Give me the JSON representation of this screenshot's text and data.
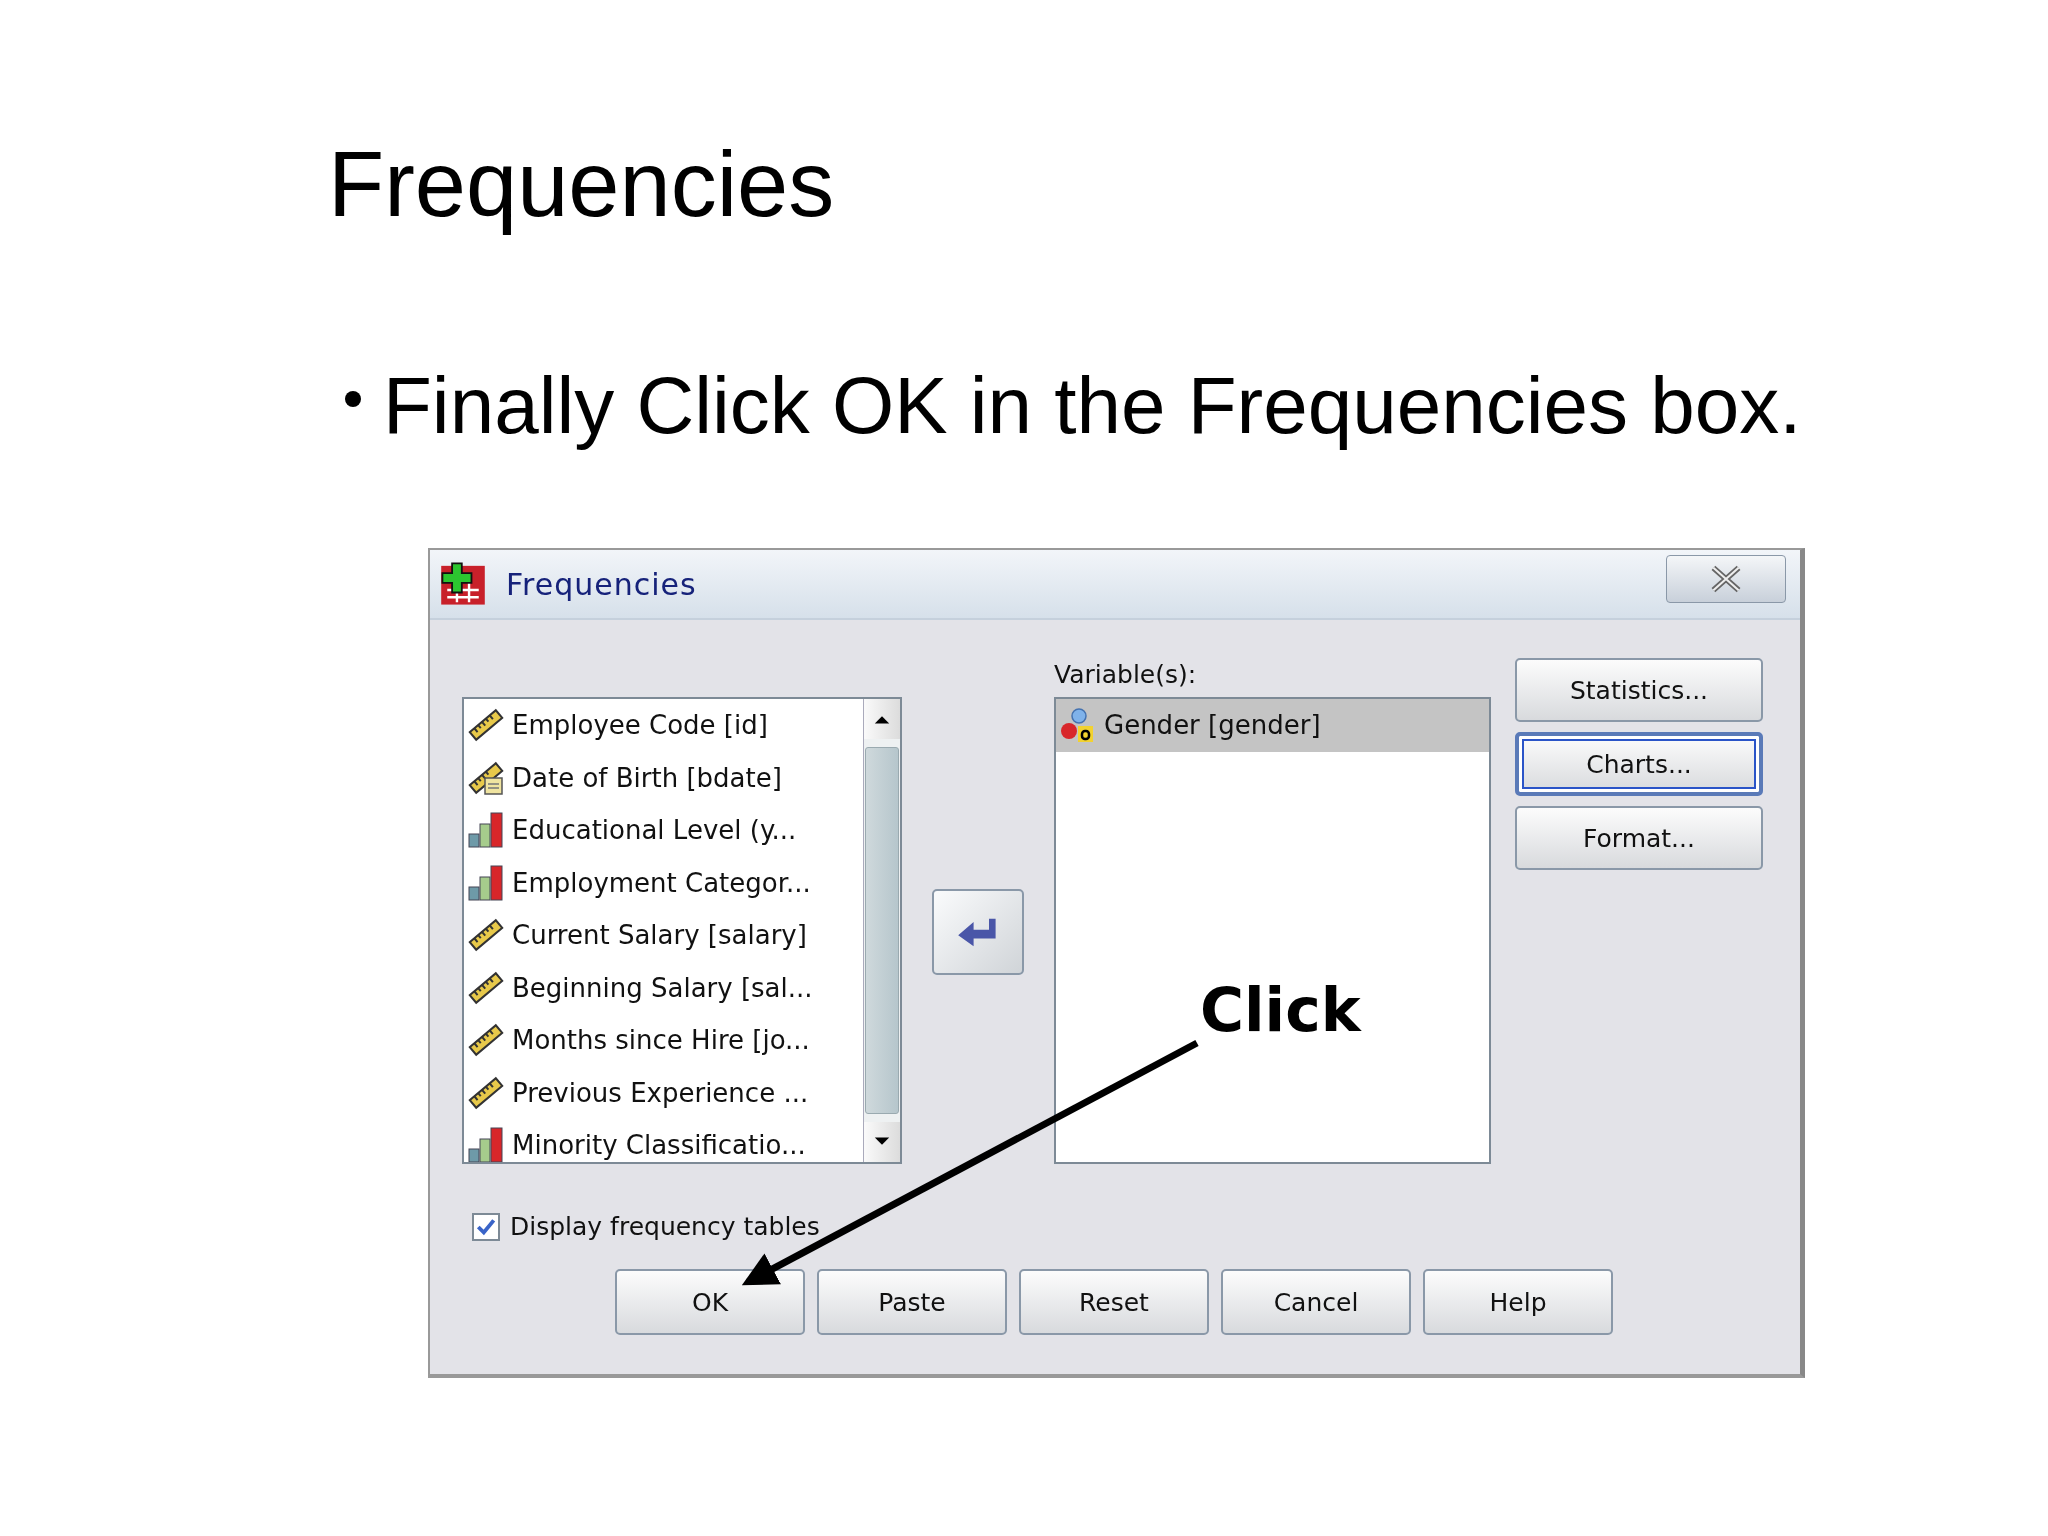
{
  "slide": {
    "title": "Frequencies",
    "bullet": "Finally Click OK in the Frequencies box."
  },
  "dialog": {
    "title": "Frequencies",
    "source_list": {
      "items": [
        {
          "label": "Employee Code [id]",
          "kind": "scale",
          "selected": false
        },
        {
          "label": "Date of Birth [bdate]",
          "kind": "date",
          "selected": false
        },
        {
          "label": "Educational Level (y...",
          "kind": "ordinal",
          "selected": false
        },
        {
          "label": "Employment Categor...",
          "kind": "ordinal",
          "selected": false
        },
        {
          "label": "Current Salary [salary]",
          "kind": "scale",
          "selected": false
        },
        {
          "label": "Beginning Salary [sal...",
          "kind": "scale",
          "selected": false
        },
        {
          "label": "Months since Hire [jo...",
          "kind": "scale",
          "selected": false
        },
        {
          "label": "Previous Experience ...",
          "kind": "scale",
          "selected": false
        },
        {
          "label": "Minority Classificatio...",
          "kind": "ordinal",
          "selected": false
        }
      ]
    },
    "variables_label": "Variable(s):",
    "variables_list": {
      "items": [
        {
          "label": "Gender [gender]",
          "kind": "nominal",
          "selected": true
        }
      ]
    },
    "side_buttons": [
      {
        "label": "Statistics...",
        "focused": false
      },
      {
        "label": "Charts...",
        "focused": true
      },
      {
        "label": "Format...",
        "focused": false
      }
    ],
    "checkbox": {
      "label": "Display frequency tables",
      "checked": true
    },
    "buttons": [
      "OK",
      "Paste",
      "Reset",
      "Cancel",
      "Help"
    ]
  },
  "annotation": {
    "text": "Click"
  }
}
